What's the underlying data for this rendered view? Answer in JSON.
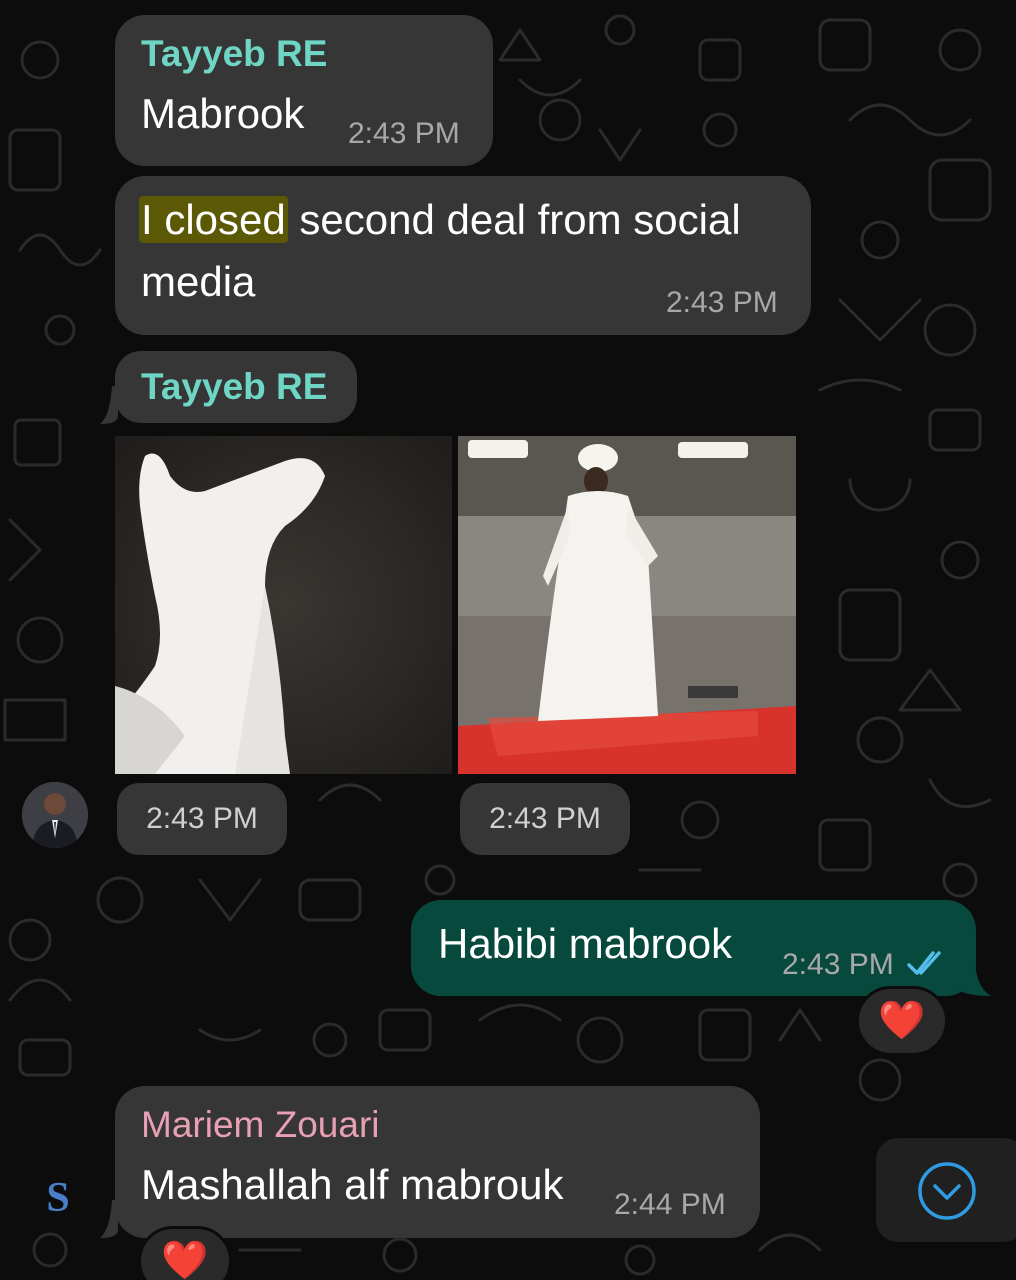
{
  "colors": {
    "incoming_bubble": "#363636",
    "outgoing_bubble": "#08493d",
    "sender_teal": "#6fd6c6",
    "sender_pink": "#e8a0b4",
    "read_tick": "#53bdeb",
    "timestamp": "#a8a8a8",
    "highlight": "#5c5906"
  },
  "messages": [
    {
      "sender": "Tayyeb RE",
      "text": "Mabrook",
      "time": "2:43 PM"
    },
    {
      "text_highlight": "I closed",
      "text_rest": " second deal from social",
      "text_line2": "media",
      "time": "2:43 PM"
    },
    {
      "sender": "Tayyeb RE",
      "media": [
        {
          "icon": "dancing-cat-image",
          "time": "2:43 PM"
        },
        {
          "icon": "dancing-man-image",
          "time": "2:43 PM"
        }
      ]
    },
    {
      "outgoing": true,
      "text": "Habibi mabrook",
      "time": "2:43 PM",
      "status_icon": "double-check-read-icon",
      "reaction": "❤️"
    },
    {
      "sender": "Mariem Zouari",
      "text": "Mashallah alf mabrouk",
      "time": "2:44 PM",
      "reaction": "❤️",
      "avatar_letter": "S"
    }
  ],
  "scroll_button_icon": "chevron-down-circle-icon"
}
